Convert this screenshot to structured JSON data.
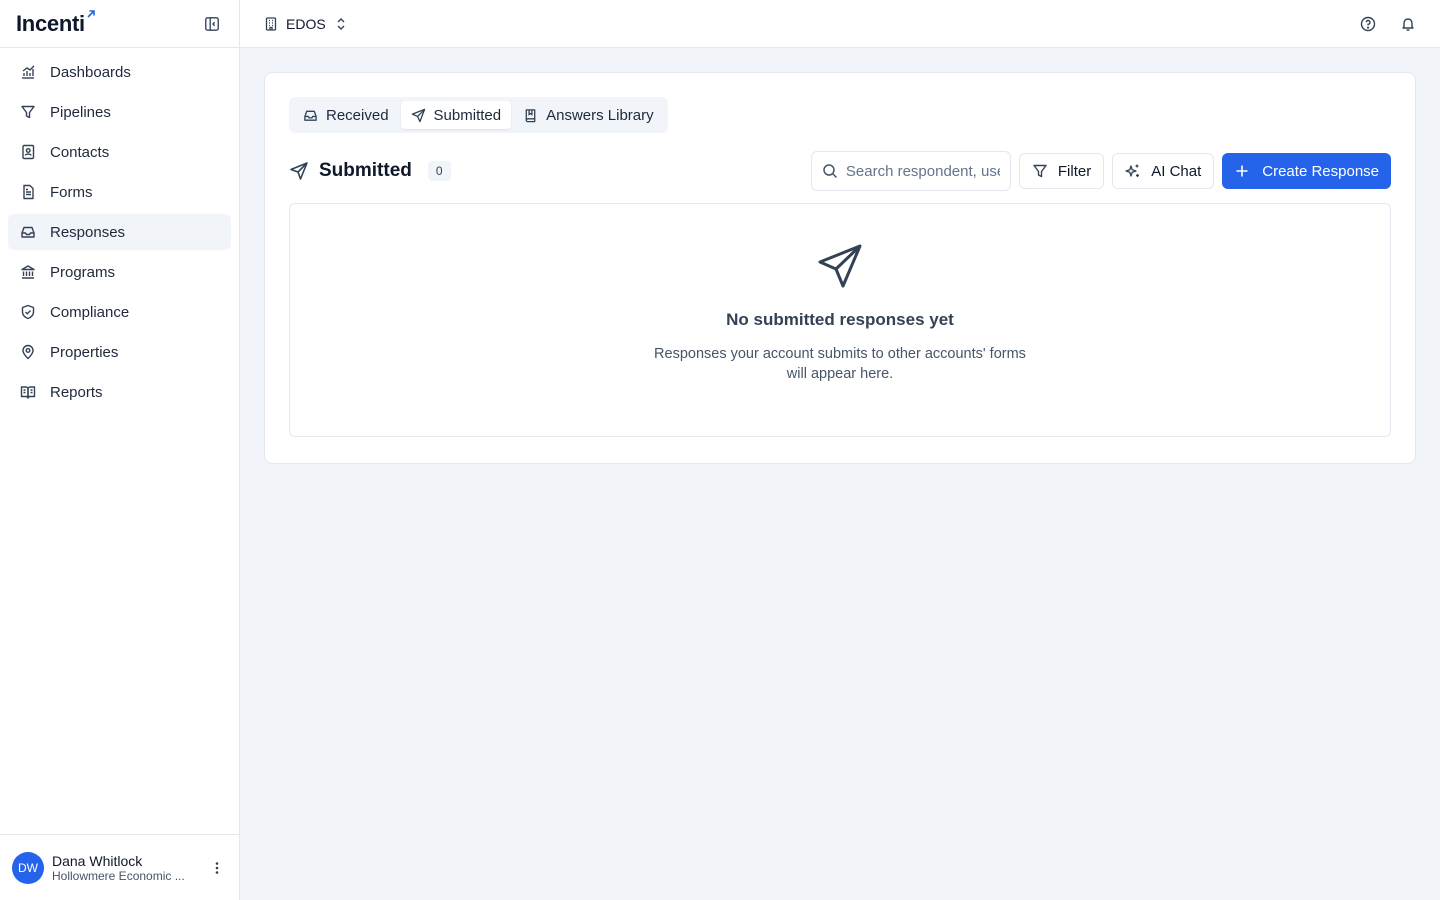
{
  "app": {
    "name": "Incenti"
  },
  "sidebar": {
    "items": [
      {
        "label": "Dashboards",
        "icon": "chart-icon"
      },
      {
        "label": "Pipelines",
        "icon": "filter-icon"
      },
      {
        "label": "Contacts",
        "icon": "contact-book-icon"
      },
      {
        "label": "Forms",
        "icon": "document-icon"
      },
      {
        "label": "Responses",
        "icon": "inbox-icon",
        "active": true
      },
      {
        "label": "Programs",
        "icon": "landmark-icon"
      },
      {
        "label": "Compliance",
        "icon": "shield-check-icon"
      },
      {
        "label": "Properties",
        "icon": "map-pin-icon"
      },
      {
        "label": "Reports",
        "icon": "book-open-icon"
      }
    ]
  },
  "user": {
    "initials": "DW",
    "name": "Dana Whitlock",
    "org": "Hollowmere Economic ..."
  },
  "topbar": {
    "org_name": "EDOS"
  },
  "tabs": [
    {
      "label": "Received",
      "icon": "inbox-icon"
    },
    {
      "label": "Submitted",
      "icon": "send-icon",
      "active": true
    },
    {
      "label": "Answers Library",
      "icon": "book-icon"
    }
  ],
  "section": {
    "title": "Submitted",
    "count": "0",
    "search_placeholder": "Search respondent, user...",
    "filter_label": "Filter",
    "ai_chat_label": "AI Chat",
    "create_label": "Create Response"
  },
  "empty_state": {
    "title": "No submitted responses yet",
    "description": "Responses your account submits to other accounts' forms will appear here."
  },
  "colors": {
    "primary": "#2563eb",
    "background": "#f1f5f9",
    "border": "#e2e8f0"
  }
}
